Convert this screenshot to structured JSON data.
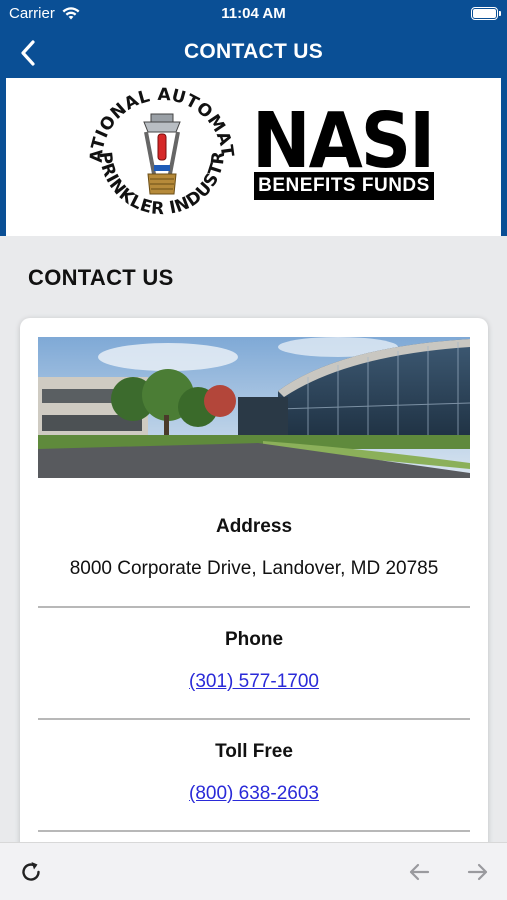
{
  "status_bar": {
    "carrier": "Carrier",
    "time": "11:04 AM"
  },
  "nav": {
    "title": "CONTACT US"
  },
  "logo": {
    "seal_text_top": "NATIONAL AUTOMATIC",
    "seal_text_bottom": "SPRINKLER INDUSTRY",
    "brand_main": "NASI",
    "brand_sub": "BENEFITS FUNDS"
  },
  "page": {
    "section_title": "CONTACT US"
  },
  "contact": {
    "address_label": "Address",
    "address_value": "8000 Corporate Drive, Landover, MD 20785",
    "phone_label": "Phone",
    "phone_value": "(301) 577-1700",
    "toll_free_label": "Toll Free",
    "toll_free_value": "(800) 638-2603"
  },
  "colors": {
    "brand_blue": "#0a4f95",
    "link": "#2a2ad8",
    "background": "#e9eaec"
  },
  "icons": {
    "back": "chevron-left-icon",
    "refresh": "refresh-icon",
    "prev": "arrow-left-icon",
    "next": "arrow-right-icon"
  }
}
